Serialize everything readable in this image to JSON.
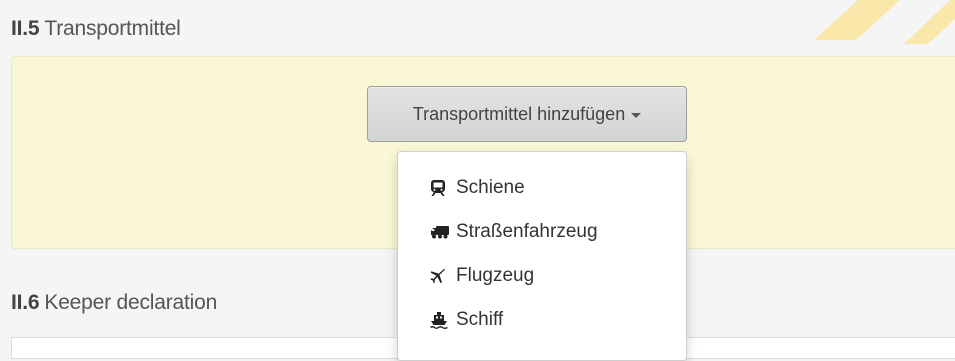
{
  "sections": [
    {
      "number": "II.5",
      "title": "Transportmittel"
    },
    {
      "number": "II.6",
      "title": "Keeper declaration"
    }
  ],
  "add_button": {
    "label": "Transportmittel hinzufügen"
  },
  "dropdown": {
    "items": [
      {
        "label": "Schiene",
        "icon": "train-icon"
      },
      {
        "label": "Straßenfahrzeug",
        "icon": "truck-icon"
      },
      {
        "label": "Flugzeug",
        "icon": "plane-icon"
      },
      {
        "label": "Schiff",
        "icon": "ship-icon"
      }
    ]
  },
  "colors": {
    "panel_background": "#faf8d4",
    "watermark": "#f5c518",
    "page_background": "#f5f5f5"
  }
}
